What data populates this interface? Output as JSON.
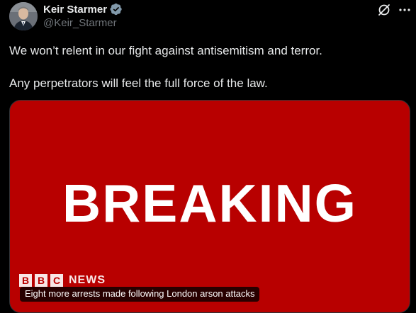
{
  "tweet": {
    "author": {
      "display_name": "Keir Starmer",
      "handle": "@Keir_Starmer",
      "verified_icon": "verified-badge-icon",
      "avatar": "profile-avatar"
    },
    "actions": {
      "grok_icon": "grok-icon",
      "more_icon": "more-options-icon"
    },
    "text": {
      "line1": "We won’t relent in our fight against antisemitism and terror.",
      "line2": "Any perpetrators will feel the full force of the law."
    },
    "media": {
      "headline": "BREAKING",
      "logo": {
        "letters": [
          "B",
          "B",
          "C"
        ],
        "wordmark": "NEWS"
      },
      "caption": "Eight more arrests made following London arson attacks",
      "background_color": "#b80000"
    }
  },
  "colors": {
    "background": "#000000",
    "text_primary": "#e7e9ea",
    "text_secondary": "#71767b",
    "verified": "#829aab"
  }
}
